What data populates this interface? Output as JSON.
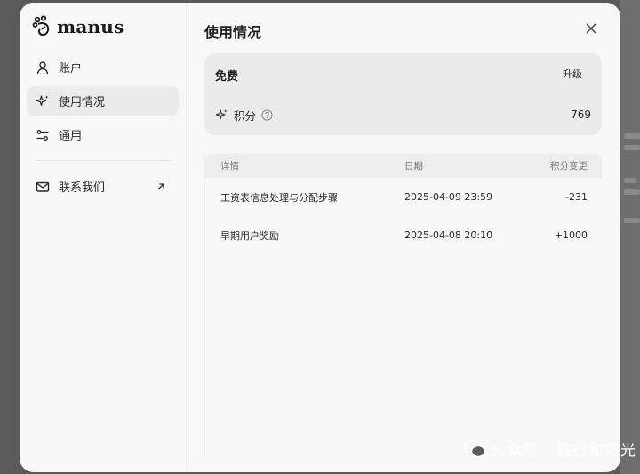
{
  "brand": {
    "name": "manus"
  },
  "sidebar": {
    "items": [
      {
        "label": "账户",
        "icon": "user-icon"
      },
      {
        "label": "使用情况",
        "icon": "sparkle-icon"
      },
      {
        "label": "通用",
        "icon": "sliders-icon"
      }
    ],
    "contact": {
      "label": "联系我们",
      "icon": "mail-icon"
    }
  },
  "main": {
    "title": "使用情况",
    "plan": {
      "name": "免费",
      "upgrade_label": "升级",
      "credits_label": "积分",
      "credits_value": "769"
    },
    "table": {
      "headers": [
        "详情",
        "日期",
        "积分变更"
      ],
      "rows": [
        {
          "detail": "工资表信息处理与分配步骤",
          "date": "2025-04-09 23:59",
          "change": "-231"
        },
        {
          "detail": "早期用户奖励",
          "date": "2025-04-08 20:10",
          "change": "+1000"
        }
      ]
    }
  },
  "watermark": {
    "text": "公众号 · 旅行和阳光"
  }
}
